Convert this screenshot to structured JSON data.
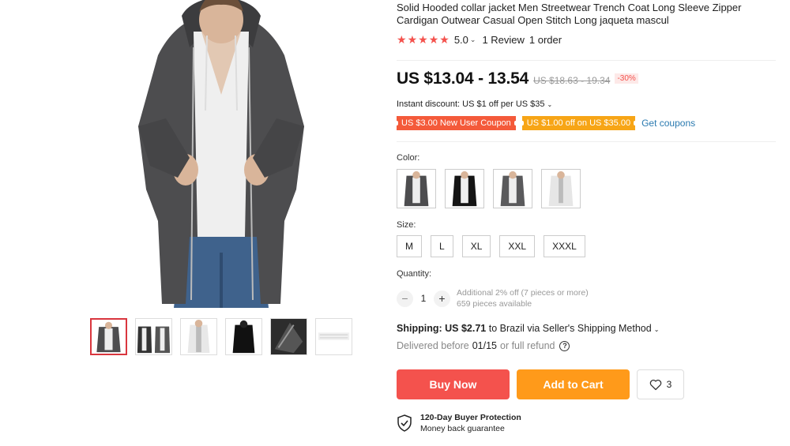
{
  "product": {
    "title": "Solid Hooded collar jacket Men Streetwear Trench Coat Long Sleeve Zipper Cardigan Outwear Casual Open Stitch Long jaqueta mascul",
    "rating": "5.0",
    "reviews": "1 Review",
    "orders": "1 order"
  },
  "price": {
    "current": "US $13.04 - 13.54",
    "original": "US $18.63 - 19.34",
    "discount": "-30%"
  },
  "instant_discount": "Instant discount: US $1 off per US $35",
  "coupons": {
    "new_user": "US $3.00 New User Coupon",
    "store": "US $1.00 off on US $35.00",
    "get_link": "Get coupons"
  },
  "color": {
    "label": "Color:",
    "options": [
      "dark-grey",
      "black",
      "grey",
      "white"
    ]
  },
  "size": {
    "label": "Size:",
    "options": [
      "M",
      "L",
      "XL",
      "XXL",
      "XXXL"
    ]
  },
  "quantity": {
    "label": "Quantity:",
    "value": "1",
    "minus": "−",
    "plus": "+",
    "bulk_note": "Additional 2% off (7 pieces or more)",
    "available": "659 pieces available"
  },
  "shipping": {
    "label": "Shipping:",
    "cost": "US $2.71",
    "rest": "to Brazil via Seller's Shipping Method",
    "delivered_prefix": "Delivered before",
    "delivered_date": "01/15",
    "delivered_suffix": "or full refund",
    "help": "?"
  },
  "actions": {
    "buy_now": "Buy Now",
    "add_to_cart": "Add to Cart",
    "wishlist_count": "3"
  },
  "protection": {
    "title": "120-Day Buyer Protection",
    "subtitle": "Money back guarantee"
  },
  "colors_theme": {
    "accent_red": "#f4524d",
    "accent_orange": "#ff9a1a",
    "link_blue": "#2a7ab0"
  },
  "icons": {
    "star": "★",
    "caret": "⌄",
    "heart": "heart-icon",
    "shield": "shield-check-icon"
  }
}
